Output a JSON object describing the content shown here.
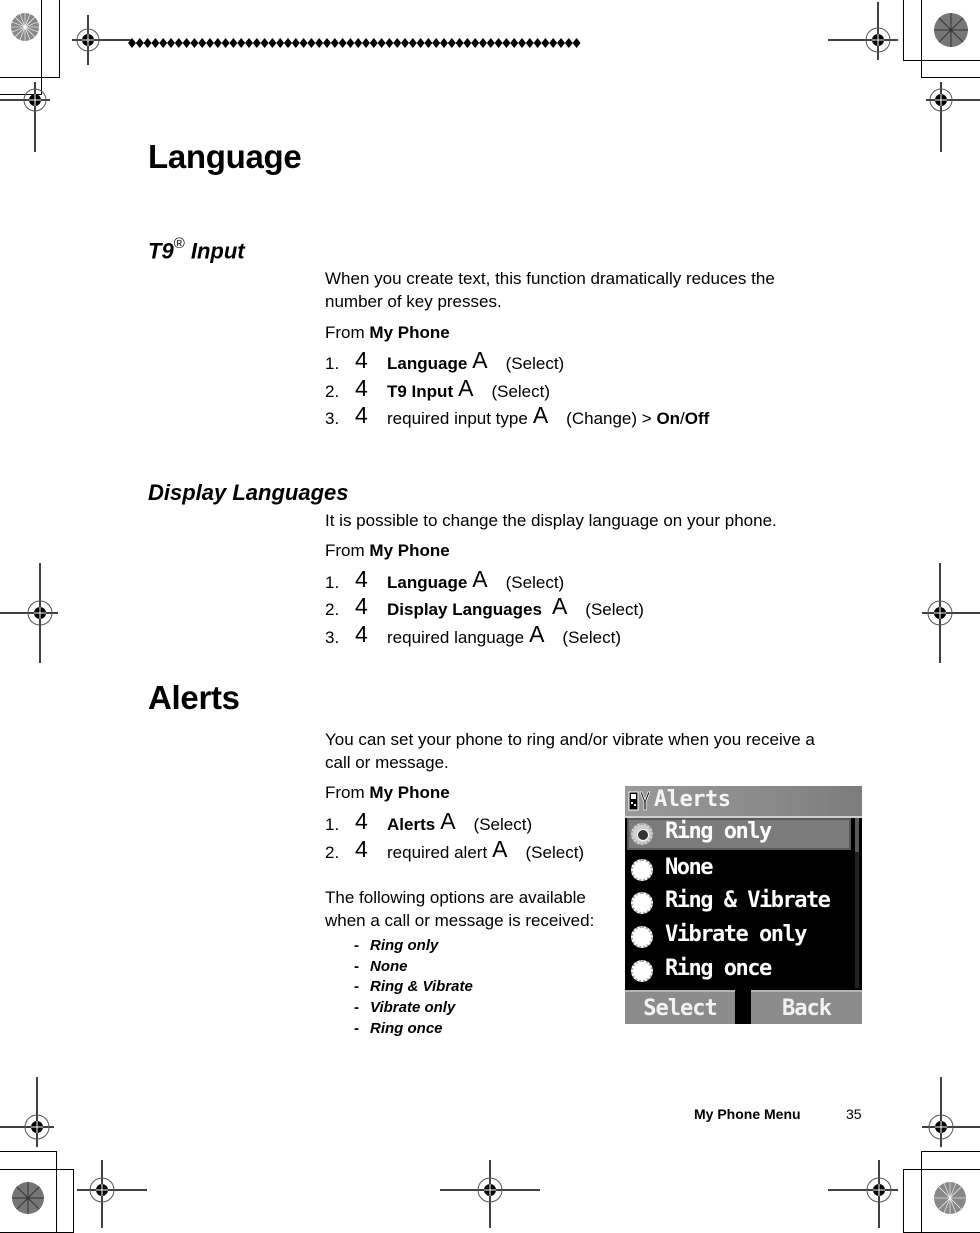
{
  "sections": {
    "language": {
      "title": "Language",
      "t9": {
        "title": "T9",
        "title_mark": "®",
        "title_suffix": "Input",
        "description_line1": "When you create text, this function dramatically reduces the",
        "description_line2": "number of key presses.",
        "from_prefix": "From",
        "from_menu": "My Phone",
        "steps": [
          {
            "num": "1.",
            "key": "4",
            "target": "Language",
            "sel_key": "A",
            "action": "(Select)"
          },
          {
            "num": "2.",
            "key": "4",
            "target": "T9 Input",
            "sel_key": "A",
            "action": "(Select)"
          },
          {
            "num": "3.",
            "key": "4",
            "target": "required input type",
            "sel_key": "A",
            "action": "(Change) >",
            "on": "On",
            "sep": "/",
            "off": "Off"
          }
        ]
      },
      "display": {
        "title": "Display Languages",
        "description": "It is possible to change the display language on your phone.",
        "from_prefix": "From",
        "from_menu": "My Phone",
        "steps": [
          {
            "num": "1.",
            "key": "4",
            "target": "Language",
            "sel_key": "A",
            "action": "(Select)"
          },
          {
            "num": "2.",
            "key": "4",
            "target": "Display Languages",
            "sel_key": "A",
            "action": "(Select)"
          },
          {
            "num": "3.",
            "key": "4",
            "target": "required language",
            "sel_key": "A",
            "action": "(Select)"
          }
        ]
      }
    },
    "alerts": {
      "title": "Alerts",
      "description_line1": "You can set your phone to ring and/or vibrate when you receive a",
      "description_line2": "call or message.",
      "from_prefix": "From",
      "from_menu": "My Phone",
      "steps": [
        {
          "num": "1.",
          "key": "4",
          "target": "Alerts",
          "sel_key": "A",
          "action": "(Select)"
        },
        {
          "num": "2.",
          "key": "4",
          "target": "required alert",
          "sel_key": "A",
          "action": "(Select)"
        }
      ],
      "options_intro_line1": "The following options are available",
      "options_intro_line2": "when a call or message is received:",
      "options": [
        "Ring only",
        "None",
        "Ring & Vibrate",
        "Vibrate only",
        "Ring once"
      ],
      "dash": "-"
    }
  },
  "phone_screen": {
    "title": "Alerts",
    "title_icon": "settings-tools-icon",
    "items": [
      {
        "label": "Ring only",
        "selected": true
      },
      {
        "label": "None",
        "selected": false
      },
      {
        "label": "Ring & Vibrate",
        "selected": false
      },
      {
        "label": "Vibrate only",
        "selected": false
      },
      {
        "label": "Ring once",
        "selected": false
      }
    ],
    "softkey_left": "Select",
    "softkey_right": "Back"
  },
  "footer": {
    "label": "My Phone Menu",
    "page": "35"
  }
}
